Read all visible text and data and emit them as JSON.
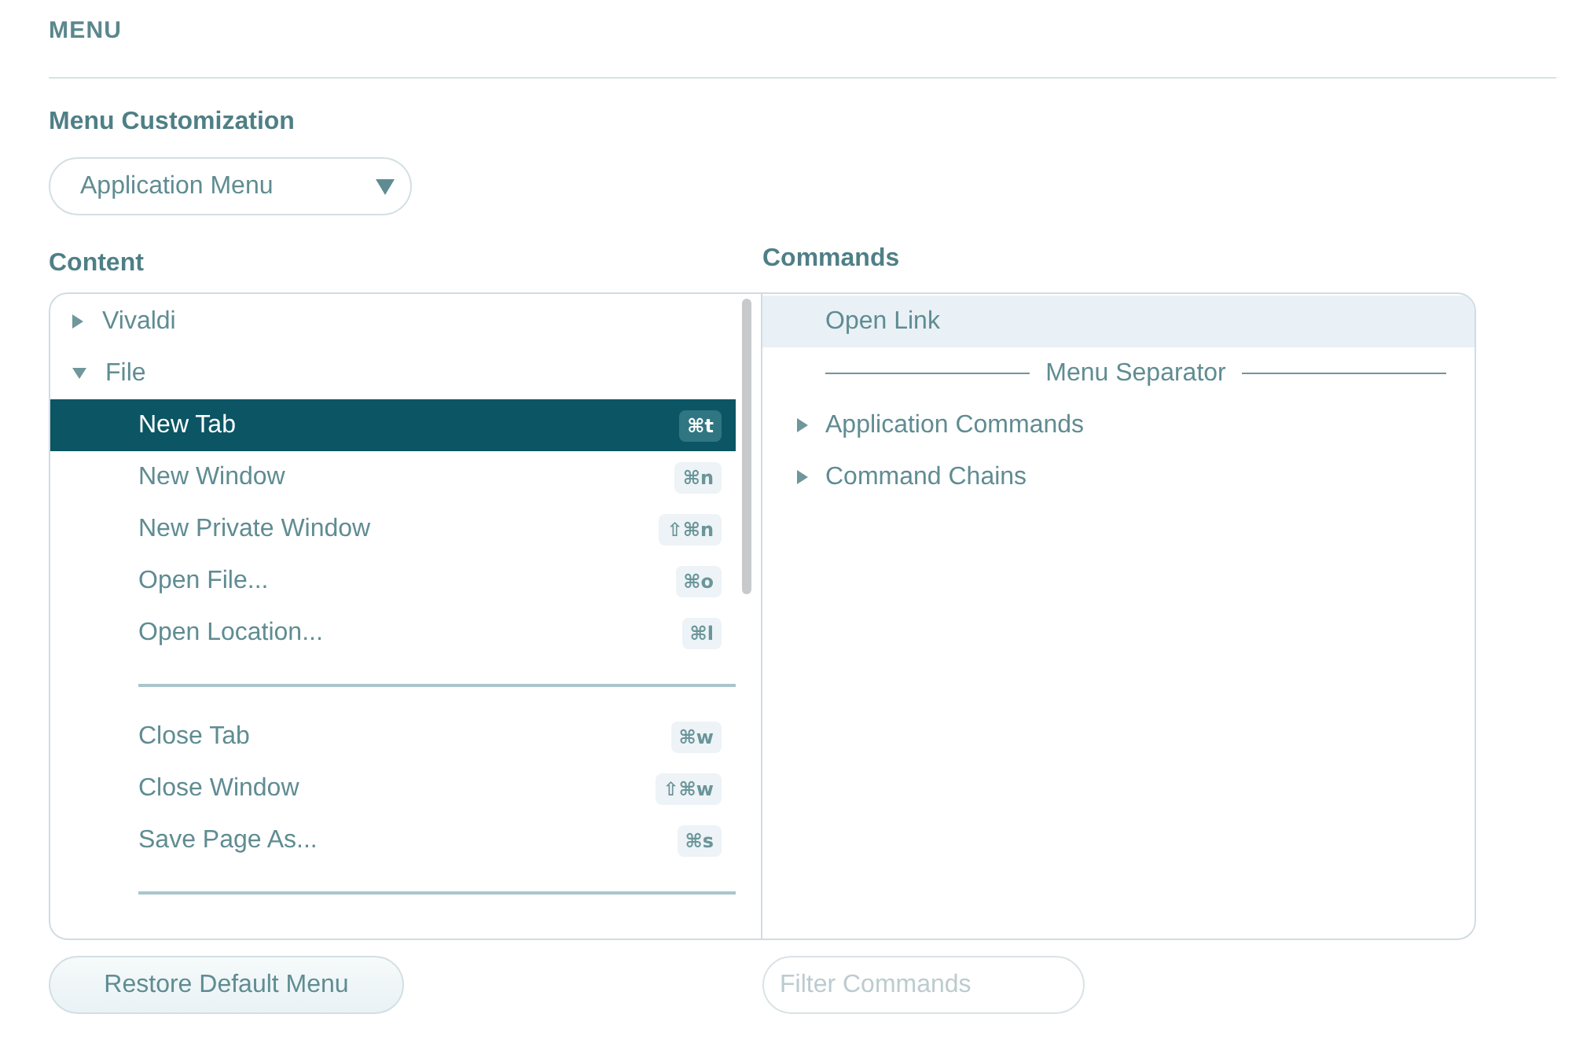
{
  "section_title": "MENU",
  "customization": {
    "label": "Menu Customization",
    "dropdown": {
      "value": "Application Menu"
    }
  },
  "content": {
    "label": "Content",
    "tree": [
      {
        "kind": "folder",
        "label": "Vivaldi",
        "expanded": false,
        "selected": false
      },
      {
        "kind": "folder",
        "label": "File",
        "expanded": true,
        "selected": false,
        "children": [
          {
            "kind": "item",
            "label": "New Tab",
            "shortcut": "⌘t",
            "selected": true
          },
          {
            "kind": "item",
            "label": "New Window",
            "shortcut": "⌘n",
            "selected": false
          },
          {
            "kind": "item",
            "label": "New Private Window",
            "shortcut": "⇧⌘n",
            "selected": false
          },
          {
            "kind": "item",
            "label": "Open File...",
            "shortcut": "⌘o",
            "selected": false
          },
          {
            "kind": "item",
            "label": "Open Location...",
            "shortcut": "⌘l",
            "selected": false
          },
          {
            "kind": "separator"
          },
          {
            "kind": "item",
            "label": "Close Tab",
            "shortcut": "⌘w",
            "selected": false
          },
          {
            "kind": "item",
            "label": "Close Window",
            "shortcut": "⇧⌘w",
            "selected": false
          },
          {
            "kind": "item",
            "label": "Save Page As...",
            "shortcut": "⌘s",
            "selected": false
          },
          {
            "kind": "separator"
          }
        ]
      }
    ]
  },
  "commands": {
    "label": "Commands",
    "items": [
      {
        "kind": "item",
        "label": "Open Link",
        "selected": true
      },
      {
        "kind": "separator",
        "label": "Menu Separator"
      },
      {
        "kind": "folder",
        "label": "Application Commands",
        "expanded": false,
        "selected": false
      },
      {
        "kind": "folder",
        "label": "Command Chains",
        "expanded": false,
        "selected": false
      }
    ]
  },
  "restore_button": {
    "label": "Restore Default Menu"
  },
  "filter": {
    "placeholder": "Filter Commands"
  }
}
